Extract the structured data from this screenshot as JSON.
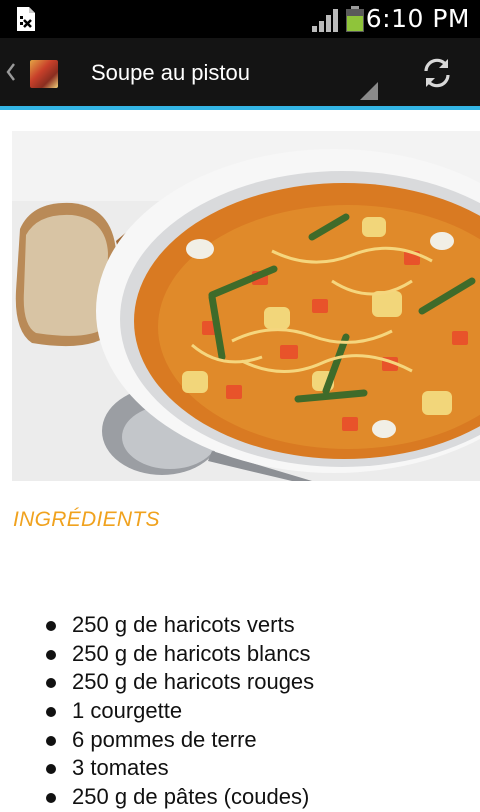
{
  "status_bar": {
    "time": "6:10 PM",
    "icons": [
      "sd-card-removed-icon",
      "signal-icon",
      "battery-icon"
    ]
  },
  "action_bar": {
    "title": "Soupe au pistou",
    "icons": [
      "back-chevron-icon",
      "app-icon",
      "spinner-indicator-icon",
      "refresh-icon"
    ],
    "accent_color": "#33b5e5"
  },
  "content": {
    "hero_image": "soup-photo",
    "section_title": "INGRÉDIENTS",
    "section_title_color": "#f0a21e",
    "ingredients": [
      "250 g de haricots verts",
      "250 g de haricots blancs",
      "250 g de haricots rouges",
      "1 courgette",
      "6 pommes de terre",
      "3 tomates",
      "250 g de pâtes (coudes)"
    ]
  }
}
